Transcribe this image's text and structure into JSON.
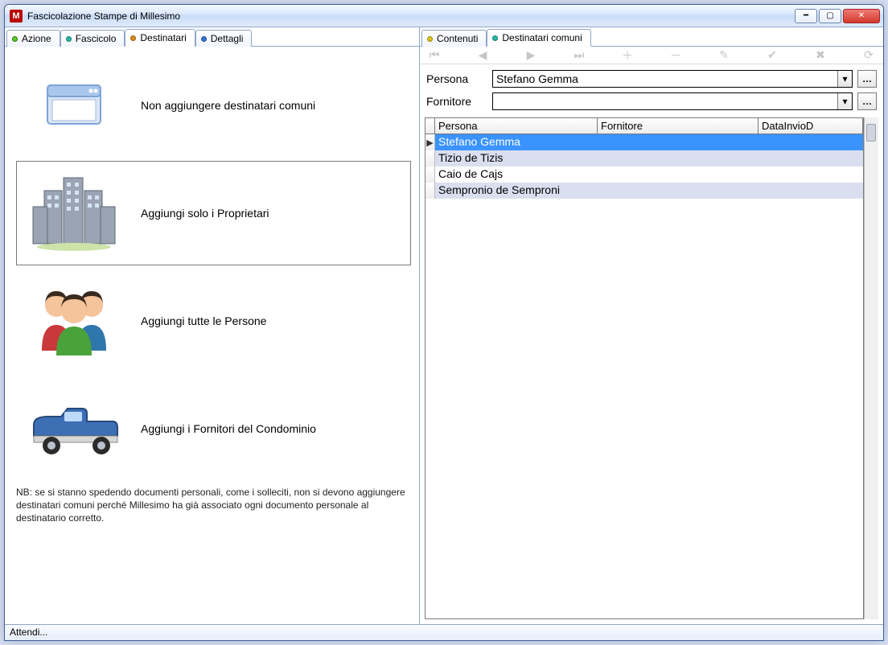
{
  "window": {
    "title": "Fascicolazione Stampe di Millesimo",
    "app_letter": "M"
  },
  "left_tabs": [
    {
      "label": "Azione",
      "dot_color": "green"
    },
    {
      "label": "Fascicolo",
      "dot_color": "teal"
    },
    {
      "label": "Destinatari",
      "dot_color": "orange",
      "active": true
    },
    {
      "label": "Dettagli",
      "dot_color": "blue"
    }
  ],
  "right_tabs": [
    {
      "label": "Contenuti",
      "dot_color": "yellow"
    },
    {
      "label": "Destinatari comuni",
      "dot_color": "teal",
      "active": true
    }
  ],
  "options": [
    {
      "label": "Non aggiungere destinatari comuni"
    },
    {
      "label": "Aggiungi solo i Proprietari",
      "selected": true
    },
    {
      "label": "Aggiungi tutte le Persone"
    },
    {
      "label": "Aggiungi i Fornitori del Condominio"
    }
  ],
  "note": "NB: se si stanno spedendo documenti personali, come i solleciti, non si devono aggiungere destinatari comuni perché Millesimo ha già associato ogni documento personale al destinatario corretto.",
  "form": {
    "persona_label": "Persona",
    "persona_value": "Stefano Gemma",
    "fornitore_label": "Fornitore",
    "fornitore_value": ""
  },
  "grid": {
    "columns": [
      "Persona",
      "Fornitore",
      "DataInvioD"
    ],
    "rows": [
      {
        "persona": "Stefano Gemma",
        "fornitore": "",
        "data": "",
        "selected": true
      },
      {
        "persona": "Tizio de Tizis",
        "fornitore": "",
        "data": "",
        "alt": true
      },
      {
        "persona": "Caio de Cajs",
        "fornitore": "",
        "data": ""
      },
      {
        "persona": "Sempronio de Semproni",
        "fornitore": "",
        "data": "",
        "alt": true
      }
    ]
  },
  "status": "Attendi...",
  "nav_icons": [
    "first",
    "prev",
    "next",
    "last",
    "add",
    "remove",
    "edit",
    "confirm",
    "delete",
    "refresh"
  ]
}
